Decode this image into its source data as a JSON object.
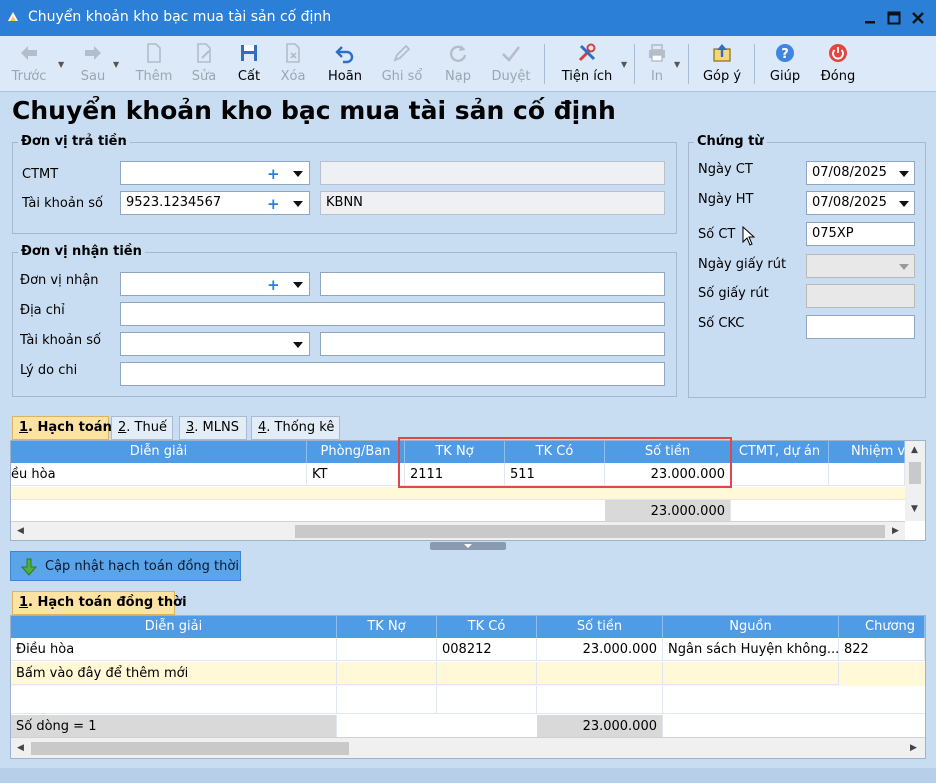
{
  "window": {
    "title": "Chuyển khoản kho bạc mua tài sản cố định"
  },
  "toolbar": {
    "prev": "Trước",
    "next": "Sau",
    "add": "Thêm",
    "edit": "Sửa",
    "save": "Cất",
    "delete": "Xóa",
    "undo": "Hoãn",
    "post": "Ghi sổ",
    "reload": "Nạp",
    "approve": "Duyệt",
    "utilities": "Tiện ích",
    "print": "In",
    "feedback": "Góp ý",
    "help": "Giúp",
    "close": "Đóng"
  },
  "form": {
    "title": "Chuyển khoản kho bạc mua tài sản cố định",
    "payer": {
      "legend": "Đơn vị trả tiền",
      "ctmt_label": "CTMT",
      "account_label": "Tài khoản số",
      "account_value": "9523.1234567",
      "account_bank": "KBNN"
    },
    "receiver": {
      "legend": "Đơn vị nhận tiền",
      "unit_label": "Đơn vị nhận",
      "address_label": "Địa chỉ",
      "account_label": "Tài khoản số",
      "reason_label": "Lý do chi"
    },
    "voucher": {
      "legend": "Chứng từ",
      "date_ct_label": "Ngày CT",
      "date_ct_value": "07/08/2025",
      "date_ht_label": "Ngày HT",
      "date_ht_value": "07/08/2025",
      "so_ct_label": "Số CT",
      "so_ct_value": "075XP",
      "ngay_giay_rut_label": "Ngày giấy rút",
      "so_giay_rut_label": "Số giấy rút",
      "so_ckc_label": "Số CKC"
    }
  },
  "tabs": [
    {
      "num": "1",
      "label": ". Hạch toán"
    },
    {
      "num": "2",
      "label": ". Thuế"
    },
    {
      "num": "3",
      "label": ". MLNS"
    },
    {
      "num": "4",
      "label": ". Thống kê"
    }
  ],
  "grid1": {
    "headers": [
      "Diễn giải",
      "Phòng/Ban",
      "TK Nợ",
      "TK Có",
      "Số tiền",
      "CTMT, dự án",
      "Nhiệm vụ"
    ],
    "rows": [
      {
        "dien_giai": "ều hòa",
        "phong_ban": "KT",
        "tk_no": "2111",
        "tk_co": "511",
        "so_tien": "23.000.000"
      }
    ],
    "total": "23.000.000"
  },
  "update_button": {
    "label": "Cập nhật hạch toán đồng thời"
  },
  "tab2": {
    "num": "1",
    "label": ". Hạch toán đồng thời"
  },
  "grid2": {
    "headers": [
      "Diễn giải",
      "TK Nợ",
      "TK Có",
      "Số tiền",
      "Nguồn",
      "Chương"
    ],
    "rows": [
      {
        "dien_giai": "Điều hòa",
        "tk_no": "",
        "tk_co": "008212",
        "so_tien": "23.000.000",
        "nguon": "Ngân sách Huyện không...",
        "chuong": "822"
      }
    ],
    "add_hint": "Bấm vào đây để thêm mới",
    "row_count": "Số dòng = 1",
    "total": "23.000.000"
  }
}
